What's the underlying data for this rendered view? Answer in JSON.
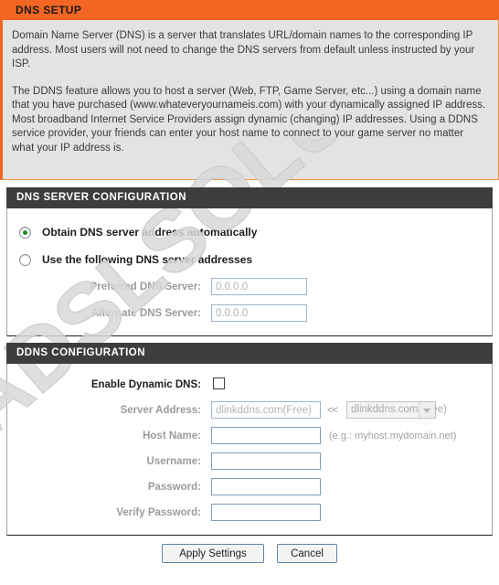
{
  "header": {
    "title": "DNS SETUP"
  },
  "description": {
    "paragraph1": "Domain Name Server (DNS) is a server that translates URL/domain names to the corresponding IP address. Most users will not need to change the DNS servers from default unless instructed by your ISP.",
    "paragraph2": "The DDNS feature allows you to host a server (Web, FTP, Game Server, etc...) using a domain name that you have purchased (www.whateveryournameis.com) with your dynamically assigned IP address. Most broadband Internet Service Providers assign dynamic (changing) IP addresses. Using a DDNS service provider, your friends can enter your host name to connect to your game server no matter what your IP address is."
  },
  "dns_server_configuration": {
    "section_title": "DNS SERVER CONFIGURATION",
    "radio_auto": {
      "label": "Obtain DNS server address automatically",
      "selected": true
    },
    "radio_manual": {
      "label": "Use the following DNS server addresses",
      "selected": false
    },
    "preferred_dns": {
      "label": "Preferred DNS Server:",
      "value": "0.0.0.0",
      "disabled": true
    },
    "alternate_dns": {
      "label": "Alternate DNS Server:",
      "value": "0.0.0.0",
      "disabled": true
    }
  },
  "ddns_configuration": {
    "section_title": "DDNS CONFIGURATION",
    "enable_dynamic_dns": {
      "label": "Enable Dynamic DNS:",
      "checked": false
    },
    "server_address": {
      "label": "Server Address:",
      "value": "dlinkddns.com(Free)",
      "arrows": "<<",
      "select_value": "dlinkddns.com(Free)",
      "disabled": true
    },
    "host_name": {
      "label": "Host Name:",
      "value": "",
      "hint": "(e.g.: myhost.mydomain.net)",
      "disabled": true
    },
    "username": {
      "label": "Username:",
      "value": "",
      "disabled": true
    },
    "password": {
      "label": "Password:",
      "value": "",
      "disabled": true
    },
    "verify_password": {
      "label": "Verify Password:",
      "value": "",
      "disabled": true
    }
  },
  "footer": {
    "apply_label": "Apply Settings",
    "cancel_label": "Cancel"
  },
  "watermark": {
    "text": "ADSLSOLUTIONS"
  },
  "colors": {
    "accent_orange": "#f26522",
    "section_header_dark": "#3d3d3d",
    "panel_gray": "#e3e3e3",
    "radio_green": "#1a8a23"
  }
}
